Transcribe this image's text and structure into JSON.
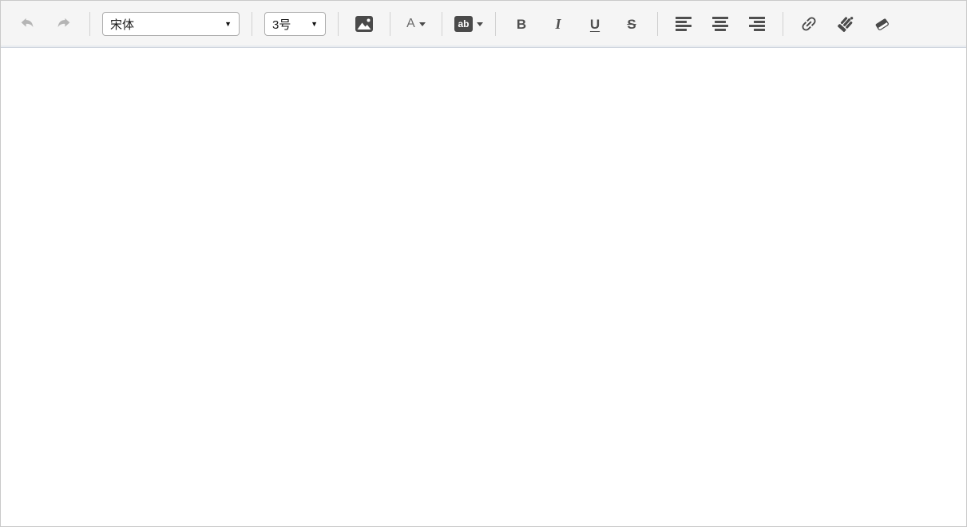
{
  "toolbar": {
    "font_family": {
      "value": "宋体"
    },
    "font_size": {
      "value": "3号"
    },
    "select_arrow": "▼",
    "font_color": {
      "label": "A"
    },
    "highlight": {
      "label": "ab"
    },
    "bold": {
      "label": "B"
    },
    "italic": {
      "label": "I"
    },
    "underline": {
      "label": "U"
    },
    "strikethrough": {
      "label": "S"
    }
  },
  "icons": {
    "undo": "undo-curved-arrow",
    "redo": "redo-curved-arrow",
    "image": "picture-with-mountain-and-dot",
    "align_left": "align-left-bars",
    "align_center": "align-center-bars",
    "align_right": "align-right-bars",
    "link": "chain-link",
    "format_brush": "paint-brush",
    "eraser": "eraser"
  },
  "colors": {
    "toolbar_bg": "#f5f5f5",
    "icon": "#4a4a4a",
    "icon_disabled": "#b5b5b5",
    "outer_border": "#c9c9c9",
    "toolbar_border_bottom": "#ccd3dc",
    "select_border": "#aeaeae"
  },
  "content": {
    "text": ""
  }
}
